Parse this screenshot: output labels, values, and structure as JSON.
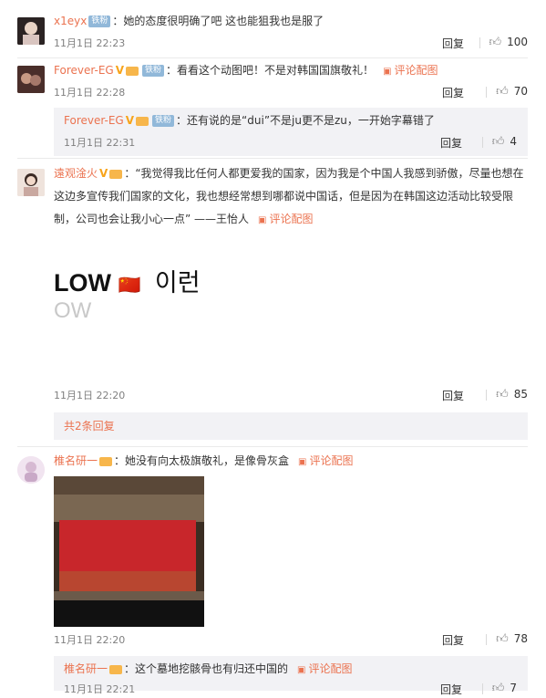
{
  "comments": [
    {
      "user": "x1eyx",
      "badge": "铁粉",
      "text": "：她的态度很明确了吧  这也能狙我也是服了",
      "time": "11月1日 22:23",
      "reply_label": "回复",
      "likes": "100"
    },
    {
      "user": "Forever-EG",
      "badge": "铁粉",
      "text": "：看看这个动图吧！不是对韩国国旗敬礼！",
      "pic_label": "评论配图",
      "time": "11月1日 22:28",
      "reply_label": "回复",
      "likes": "70",
      "sub": {
        "user": "Forever-EG",
        "badge": "铁粉",
        "text": "：还有说的是“dui”不是ju更不是zu，一开始字幕错了",
        "time": "11月1日 22:31",
        "reply_label": "回复",
        "likes": "4"
      }
    },
    {
      "user": "遠观淦火",
      "text_line1": "：“我觉得我比任何人都更爱我的国家，因为我是个中国人我感到骄傲，尽量也想在",
      "text_line2": "这边多宣传我们国家的文化，我也想经常想到哪都说中国话，但是因为在韩国这边活动比较受限",
      "text_line3": "制，公司也会让我小心一点”    ——王怡人",
      "pic_label": "评论配图",
      "image_text_main": "LOW",
      "image_text_flag": "🇨🇳",
      "image_text_korean": "이런",
      "image_text_sub": "OW",
      "time": "11月1日 22:20",
      "reply_label": "回复",
      "likes": "85",
      "more_replies": "共2条回复"
    },
    {
      "user": "椎名研一",
      "text": "：她没有向太极旗敬礼，是像骨灰盒",
      "pic_label": "评论配图",
      "time": "11月1日 22:20",
      "reply_label": "回复",
      "likes": "78",
      "sub": {
        "user": "椎名研一",
        "text": "：这个墓地挖骸骨也有归还中国的",
        "pic_label": "评论配图",
        "time": "11月1日 22:21",
        "reply_label": "回复",
        "likes": "7"
      }
    }
  ],
  "icons": {
    "thumb": "thumb-up-icon",
    "pic": "picture-icon",
    "verified": "verified-v-icon"
  },
  "colors": {
    "name": "#eb7350",
    "subbg": "#f2f2f5",
    "badge": "#91b8d9"
  }
}
